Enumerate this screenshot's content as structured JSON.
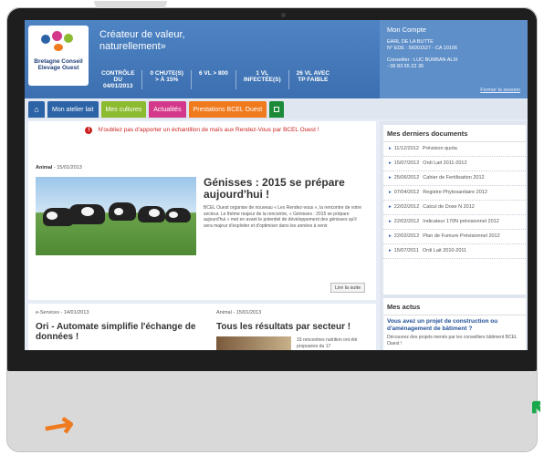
{
  "header": {
    "logo_text": "Bretagne Conseil Elevage Ouest",
    "tagline_line1": "Créateur de valeur,",
    "tagline_line2": "naturellement»",
    "stats": [
      {
        "line1": "CONTRÔLE",
        "line2": "DU",
        "line3": "04/01/2013"
      },
      {
        "line1": "0 CHUTE(S)",
        "line2": "> À 15%",
        "line3": ""
      },
      {
        "line1": "6 VL > 800",
        "line2": "",
        "line3": ""
      },
      {
        "line1": "1 VL",
        "line2": "INFECTÉE(S)",
        "line3": ""
      },
      {
        "line1": "26 VL AVEC",
        "line2": "TP FAIBLE",
        "line3": ""
      }
    ]
  },
  "account": {
    "title": "Mon Compte",
    "line1": "EARL DE LA BUTTE",
    "line2": "N° EDE : 56001527 - CA 10106",
    "line3": "Conseiller : LUC BURBAN ALIX",
    "line4": "- 06 83 65 22 36",
    "logout": "Fermer la session"
  },
  "nav": {
    "home_icon": "house-icon",
    "tabs": [
      {
        "label": "Mon atelier lait",
        "color": "#2c62a6"
      },
      {
        "label": "Mes cultures",
        "color": "#8dbb2f"
      },
      {
        "label": "Actualités",
        "color": "#d4388b"
      },
      {
        "label": "Prestations BCEL Ouest",
        "color": "#f07a1e"
      }
    ],
    "extra_icon": "green-square-icon"
  },
  "alert": {
    "text": "N'oubliez pas d'apporter un échantillon de maïs aux Rendez-Vous par BCEL Ouest !"
  },
  "featured": {
    "category": "Animal",
    "date": "- 15/01/2013",
    "title": "Génisses : 2015 se prépare aujourd'hui !",
    "body": "BCEL Ouest organise de nouveau « Les Rendez-vous », la rencontre de votre secteur. Le thème majeur de la rencontre, « Génisses : 2015 se prépare aujourd'hui » met en avant le potentiel de développement des génisses qu'il sera majeur d'exploiter et d'optimiser dans les années à venir.",
    "read_more": "Lire la suite"
  },
  "article2": {
    "category": "e-Services",
    "date": "- 14/01/2013",
    "title": "Ori - Automate simplifie l'échange de données !"
  },
  "article3": {
    "category": "Animal",
    "date": "- 15/01/2013",
    "title": "Tous les résultats par secteur !",
    "body": "33 rencontres nutrition ont été proposées du 17"
  },
  "documents": {
    "title": "Mes derniers documents",
    "items": [
      {
        "date": "11/12/2012",
        "name": "Prévision quota"
      },
      {
        "date": "15/07/2012",
        "name": "Ordi Lait 2011-2012"
      },
      {
        "date": "25/06/2012",
        "name": "Cahier de Fertilisation 2012"
      },
      {
        "date": "07/04/2012",
        "name": "Registre Phytosanitaire 2012"
      },
      {
        "date": "22/02/2012",
        "name": "Calcul de Dose N 2012"
      },
      {
        "date": "22/02/2012",
        "name": "Indicateur 170N prévisionnel 2012"
      },
      {
        "date": "22/02/2012",
        "name": "Plan de Fumure Prévisionnel 2012"
      },
      {
        "date": "15/07/2011",
        "name": "Ordi Lait 2010-2011"
      }
    ]
  },
  "actus": {
    "title": "Mes actus",
    "headline": "Vous avez un projet de construction ou d'aménagement de bâtiment ?",
    "body": "Découvrez des projets menés par les conseillers bâtiment BCEL Ouest !"
  }
}
